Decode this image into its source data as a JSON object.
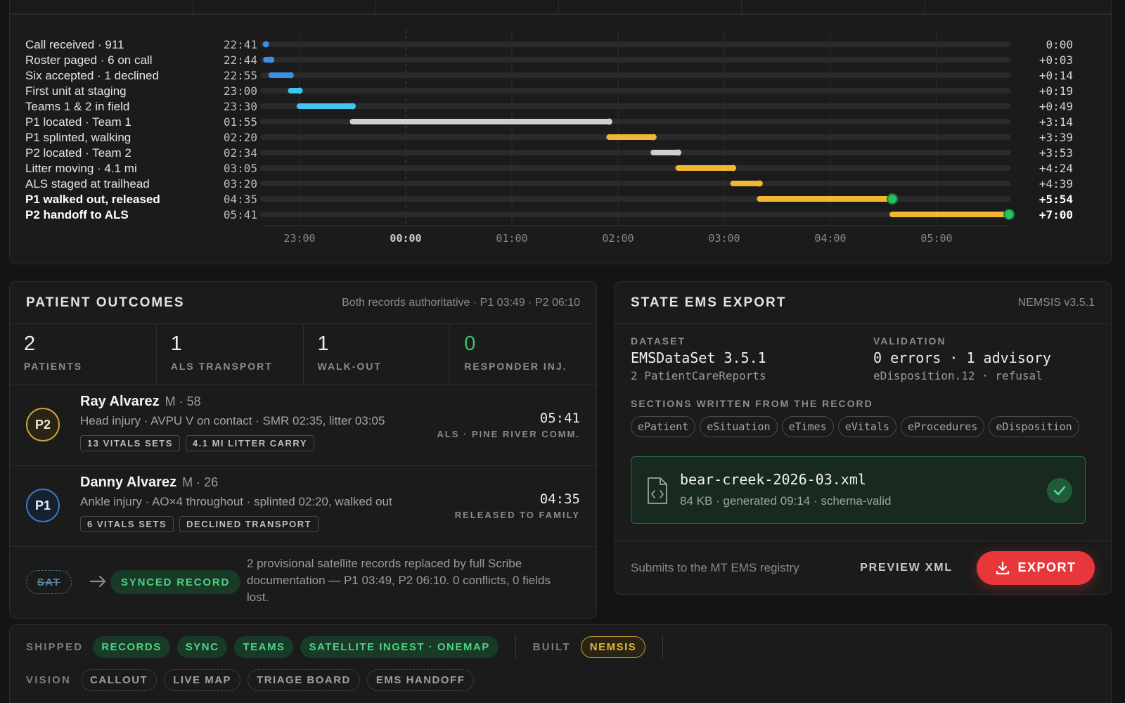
{
  "timeline": {
    "axis_ticks": [
      "23:00",
      "00:00",
      "01:00",
      "02:00",
      "03:00",
      "04:00",
      "05:00"
    ],
    "events": [
      {
        "label": "Call received · 911",
        "time": "22:41",
        "elapsed": "0:00",
        "start": "22:41",
        "end": "22:41",
        "color": "#3b8fe6",
        "bold": false
      },
      {
        "label": "Roster paged · 6 on call",
        "time": "22:44",
        "elapsed": "+0:03",
        "start": "22:41",
        "end": "22:44",
        "color": "#3b8fe6",
        "bold": false
      },
      {
        "label": "Six accepted · 1 declined",
        "time": "22:55",
        "elapsed": "+0:14",
        "start": "22:44",
        "end": "22:55",
        "color": "#3b8fe6",
        "bold": false
      },
      {
        "label": "First unit at staging",
        "time": "23:00",
        "elapsed": "+0:19",
        "start": "22:55",
        "end": "23:00",
        "color": "#3fc6ee",
        "bold": false
      },
      {
        "label": "Teams 1 & 2 in field",
        "time": "23:30",
        "elapsed": "+0:49",
        "start": "23:00",
        "end": "23:30",
        "color": "#3fc6ee",
        "bold": false
      },
      {
        "label": "P1 located · Team 1",
        "time": "01:55",
        "elapsed": "+3:14",
        "start": "23:30",
        "end": "01:55",
        "color": "#cfcfcf",
        "bold": false
      },
      {
        "label": "P1 splinted, walking",
        "time": "02:20",
        "elapsed": "+3:39",
        "start": "01:55",
        "end": "02:20",
        "color": "#f2b632",
        "bold": false
      },
      {
        "label": "P2 located · Team 2",
        "time": "02:34",
        "elapsed": "+3:53",
        "start": "02:20",
        "end": "02:34",
        "color": "#cfcfcf",
        "bold": false
      },
      {
        "label": "Litter moving · 4.1 mi",
        "time": "03:05",
        "elapsed": "+4:24",
        "start": "02:34",
        "end": "03:05",
        "color": "#f2b632",
        "bold": false
      },
      {
        "label": "ALS staged at trailhead",
        "time": "03:20",
        "elapsed": "+4:39",
        "start": "03:05",
        "end": "03:20",
        "color": "#f2b632",
        "bold": false
      },
      {
        "label": "P1 walked out, released",
        "time": "04:35",
        "elapsed": "+5:54",
        "start": "03:20",
        "end": "04:35",
        "color": "#f2b632",
        "bold": true
      },
      {
        "label": "P2 handoff to ALS",
        "time": "05:41",
        "elapsed": "+7:00",
        "start": "04:35",
        "end": "05:41",
        "color": "#f2b632",
        "bold": true
      }
    ]
  },
  "outcomes": {
    "title": "PATIENT OUTCOMES",
    "meta": "Both records authoritative · P1 03:49 · P2 06:10",
    "stats": [
      {
        "num": "2",
        "label": "PATIENTS"
      },
      {
        "num": "1",
        "label": "ALS TRANSPORT"
      },
      {
        "num": "1",
        "label": "WALK-OUT"
      },
      {
        "num": "0",
        "label": "RESPONDER INJ."
      }
    ],
    "patients": [
      {
        "badge": "P2",
        "name": "Ray Alvarez",
        "meta": "M · 58",
        "desc": "Head injury · AVPU V on contact · SMR 02:35, litter 03:05",
        "tags": [
          "13 VITALS SETS",
          "4.1 MI LITTER CARRY"
        ],
        "time": "05:41",
        "dest": "ALS · PINE RIVER COMM."
      },
      {
        "badge": "P1",
        "name": "Danny Alvarez",
        "meta": "M · 26",
        "desc": "Ankle injury · AO×4 throughout · splinted 02:20, walked out",
        "tags": [
          "6 VITALS SETS",
          "DECLINED TRANSPORT"
        ],
        "time": "04:35",
        "dest": "RELEASED TO FAMILY"
      }
    ],
    "sync": {
      "sat_label": "SAT",
      "synced_label": "SYNCED RECORD",
      "text": "2 provisional satellite records replaced by full Scribe documentation — P1 03:49, P2 06:10. 0 conflicts, 0 fields lost."
    }
  },
  "export": {
    "title": "STATE EMS EXPORT",
    "meta": "NEMSIS v3.5.1",
    "dataset_label": "DATASET",
    "dataset_value": "EMSDataSet 3.5.1",
    "dataset_sub": "2 PatientCareReports",
    "validation_label": "VALIDATION",
    "validation_value": "0 errors · 1 advisory",
    "validation_sub": "eDisposition.12 · refusal",
    "sections_label": "SECTIONS WRITTEN FROM THE RECORD",
    "sections": [
      "ePatient",
      "eSituation",
      "eTimes",
      "eVitals",
      "eProcedures",
      "eDisposition"
    ],
    "file_name": "bear-creek-2026-03.xml",
    "file_meta": "84 KB · generated 09:14 · schema-valid",
    "footer_text": "Submits to the MT EMS registry",
    "preview_label": "PREVIEW XML",
    "export_label": "EXPORT"
  },
  "status": {
    "shipped_label": "SHIPPED",
    "shipped": [
      "RECORDS",
      "SYNC",
      "TEAMS",
      "SATELLITE INGEST · ONEMAP"
    ],
    "built_label": "BUILT",
    "built": [
      "NEMSIS"
    ],
    "vision_label": "VISION",
    "vision": [
      "CALLOUT",
      "LIVE MAP",
      "TRIAGE BOARD",
      "EMS HANDOFF"
    ]
  },
  "colors": {
    "accent_red": "#e8373a",
    "green": "#4fd187",
    "amber": "#f2b632",
    "blue": "#3b8fe6",
    "cyan": "#3fc6ee"
  }
}
